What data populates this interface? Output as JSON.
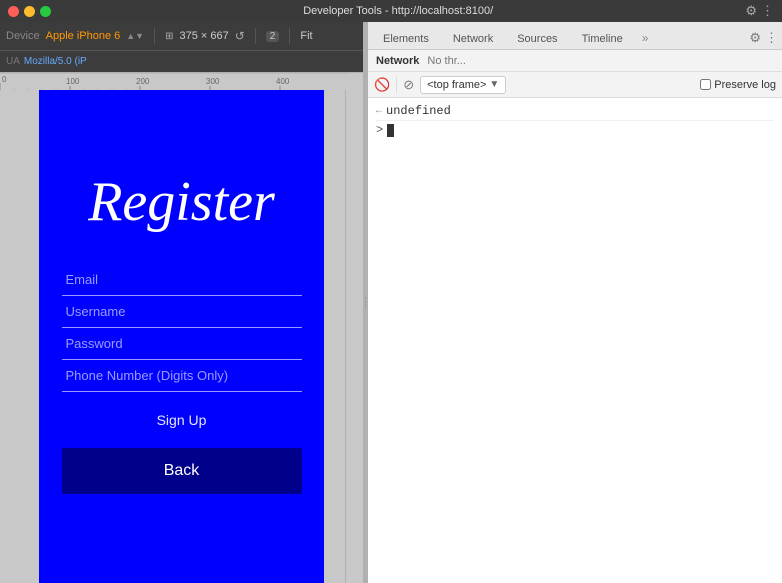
{
  "window": {
    "title": "Developer Tools - http://localhost:8100/",
    "traffic_lights": {
      "close": "close",
      "minimize": "minimize",
      "maximize": "maximize"
    }
  },
  "device_toolbar": {
    "device_label": "Device",
    "device_name": "Apple iPhone 6",
    "dimensions": "375 × 667",
    "zoom": "Fit",
    "ua_label": "UA",
    "ua_value": "Mozilla/5.0 (iP",
    "badge_value": "2"
  },
  "phone": {
    "register_title": "Register",
    "fields": [
      {
        "placeholder": "Email",
        "type": "email"
      },
      {
        "placeholder": "Username",
        "type": "text"
      },
      {
        "placeholder": "Password",
        "type": "password"
      },
      {
        "placeholder": "Phone Number (Digits Only)",
        "type": "tel"
      }
    ],
    "sign_up_label": "Sign Up",
    "back_label": "Back"
  },
  "devtools": {
    "tabs": [
      {
        "label": "Elements",
        "active": false
      },
      {
        "label": "Network",
        "active": false
      },
      {
        "label": "Sources",
        "active": false
      },
      {
        "label": "Timeline",
        "active": false
      }
    ],
    "network_tab": {
      "label": "Network",
      "throttle": "No thr..."
    },
    "console": {
      "frame_label": "<top frame>",
      "preserve_log": "Preserve log",
      "lines": [
        {
          "arrow": "←",
          "text": "undefined"
        }
      ],
      "prompt_arrow": ">"
    }
  },
  "ruler": {
    "marks": [
      "0",
      "100",
      "200",
      "300",
      "400"
    ]
  },
  "icons": {
    "back_arrow": "←",
    "filter": "⊘",
    "refresh": "↻",
    "gear": "⚙",
    "dots": "⋮",
    "more_tabs": "»"
  }
}
